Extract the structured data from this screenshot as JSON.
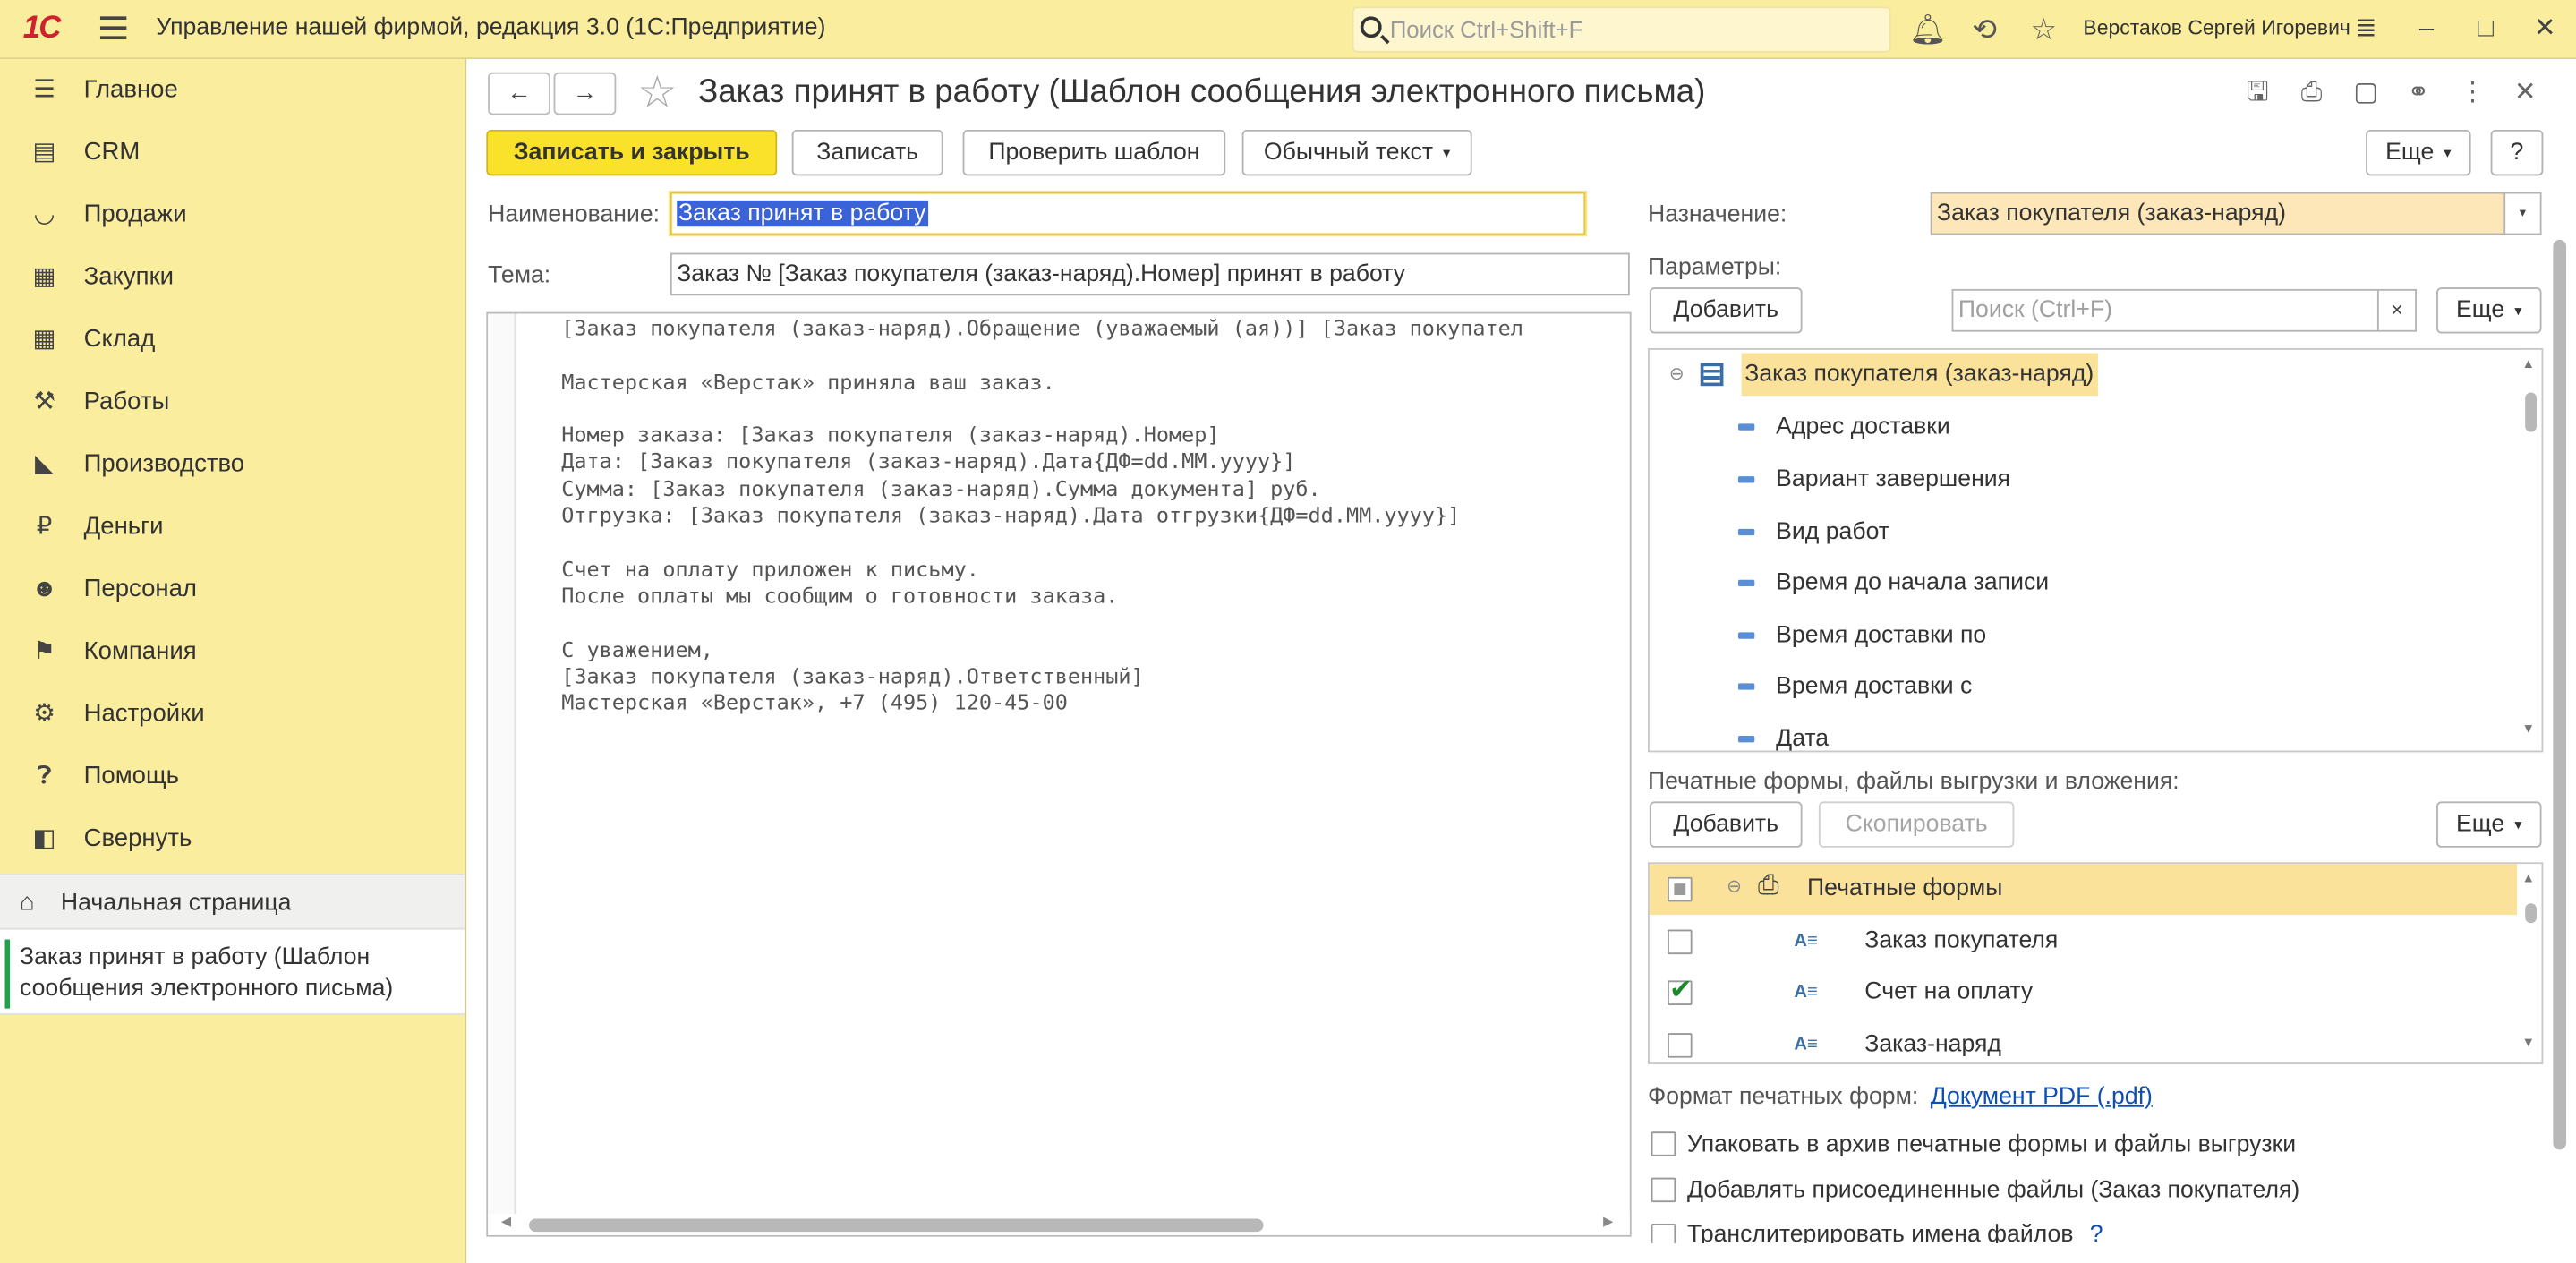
{
  "app": {
    "logo": "1С",
    "title": "Управление нашей фирмой, редакция 3.0  (1С:Предприятие)",
    "search_placeholder": "Поиск Ctrl+Shift+F",
    "user": "Верстаков Сергей Игоревич"
  },
  "sidebar": {
    "items": [
      {
        "label": "Главное",
        "icon": "menu-lines-icon"
      },
      {
        "label": "CRM",
        "icon": "crm-icon"
      },
      {
        "label": "Продажи",
        "icon": "basket-icon"
      },
      {
        "label": "Закупки",
        "icon": "cart-icon"
      },
      {
        "label": "Склад",
        "icon": "warehouse-icon"
      },
      {
        "label": "Работы",
        "icon": "tools-icon"
      },
      {
        "label": "Производство",
        "icon": "factory-icon"
      },
      {
        "label": "Деньги",
        "icon": "ruble-icon"
      },
      {
        "label": "Персонал",
        "icon": "person-icon"
      },
      {
        "label": "Компания",
        "icon": "flag-icon"
      },
      {
        "label": "Настройки",
        "icon": "gear-icon"
      },
      {
        "label": "Помощь",
        "icon": "help-icon"
      },
      {
        "label": "Свернуть",
        "icon": "collapse-icon"
      }
    ],
    "home": "Начальная страница",
    "active_window": "Заказ принят в работу (Шаблон сообщения электронного письма)"
  },
  "form": {
    "title": "Заказ принят в работу (Шаблон сообщения электронного письма)",
    "toolbar": {
      "save_close": "Записать и закрыть",
      "save": "Записать",
      "check": "Проверить шаблон",
      "format": "Обычный текст",
      "more": "Еще",
      "help": "?"
    },
    "name_label": "Наименование:",
    "name_value": "Заказ принят в работу",
    "subject_label": "Тема:",
    "subject_value": "Заказ № [Заказ покупателя (заказ-наряд).Номер] принят в работу",
    "body": " [Заказ покупателя (заказ-наряд).Обращение (уважаемый (ая))] [Заказ покупател\n\n Мастерская «Верстак» приняла ваш заказ.\n\n Номер заказа: [Заказ покупателя (заказ-наряд).Номер]\n Дата: [Заказ покупателя (заказ-наряд).Дата{ДФ=dd.MM.yyyy}]\n Сумма: [Заказ покупателя (заказ-наряд).Сумма документа] руб.\n Отгрузка: [Заказ покупателя (заказ-наряд).Дата отгрузки{ДФ=dd.MM.yyyy}]\n\n Счет на оплату приложен к письму.\n После оплаты мы сообщим о готовности заказа.\n\n С уважением,\n [Заказ покупателя (заказ-наряд).Ответственный]\n Мастерская «Верстак», +7 (495) 120-45-00",
    "purpose_label": "Назначение:",
    "purpose_value": "Заказ покупателя (заказ-наряд)",
    "params_label": "Параметры:",
    "add": "Добавить",
    "search_placeholder": "Поиск (Ctrl+F)",
    "clear": "×",
    "params_root": "Заказ покупателя (заказ-наряд)",
    "params": [
      "Адрес доставки",
      "Вариант завершения",
      "Вид работ",
      "Время до начала записи",
      "Время доставки по",
      "Время доставки с",
      "Дата"
    ],
    "attachments_label": "Печатные формы, файлы выгрузки и вложения:",
    "copy": "Скопировать",
    "print_root": "Печатные формы",
    "print_forms": [
      {
        "label": "Заказ покупателя",
        "checked": false
      },
      {
        "label": "Счет на оплату",
        "checked": true
      },
      {
        "label": "Заказ-наряд",
        "checked": false
      }
    ],
    "format_label": "Формат печатных форм:",
    "format_link": "Документ PDF (.pdf)",
    "options": [
      "Упаковать в архив печатные формы и файлы выгрузки",
      "Добавлять присоединенные файлы (Заказ покупателя)",
      "Транслитерировать имена файлов"
    ],
    "option_help": "?"
  }
}
